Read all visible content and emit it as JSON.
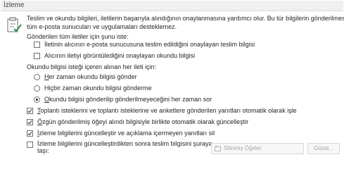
{
  "section": {
    "title": "İzleme"
  },
  "description": {
    "line1": "Teslim ve okundu bilgileri, iletilerin başarıyla alındığının onaylanmasına yardımcı olur. Bu tür bilgilerin gönderilmesini",
    "line2": "tüm e-posta sunucuları ve uygulamaları desteklemez."
  },
  "sent_messages": {
    "heading": "Gönderilen tüm iletiler için şunu iste:",
    "delivery_receipt": {
      "label": "İletinin alıcının e-posta sunucusuna teslim edildiğini onaylayan teslim bilgisi",
      "checked": false
    },
    "read_receipt": {
      "label": "Alıcının iletiyi görüntülediğini onaylayan okundu bilgisi",
      "checked": false
    }
  },
  "read_receipt_request": {
    "heading": "Okundu bilgisi isteği içeren alınan her ileti için:",
    "options": [
      {
        "label_pre": "",
        "underline": "H",
        "label_post": "er zaman okundu bilgisi gönder",
        "selected": false
      },
      {
        "label_pre": "Hi",
        "underline": "ç",
        "label_post": "bir zaman okundu bilgisi gönderme",
        "selected": false
      },
      {
        "label_pre": "",
        "underline": "O",
        "label_post": "kundu bilgisi gönderilip gönderilmeyeceğini her zaman sor",
        "selected": true
      }
    ]
  },
  "auto_options": [
    {
      "label_pre": "",
      "underline": "T",
      "label_post": "oplantı isteklerini ve toplantı isteklerine ve anketlere gönderilen yanıtları otomatik olarak işle",
      "checked": true
    },
    {
      "label_pre": "",
      "underline": "Ö",
      "label_post": "zgün gönderilmiş öğeyi alındı bilgisiyle birlikte otomatik olarak güncelleştir",
      "checked": true
    },
    {
      "label_pre": "",
      "underline": "İ",
      "label_post": "zleme bilgilerini güncelleştir ve açıklama içermeyen yanıtları sil",
      "checked": true
    }
  ],
  "move_after_update": {
    "label_line1": "İzleme bilgilerini güncelleştirdikten sonra teslim bilgisini şuraya",
    "label_line2": "taşı:",
    "checked": false,
    "folder": "Silinmiş Öğeler",
    "browse_label": "Gözat..."
  }
}
